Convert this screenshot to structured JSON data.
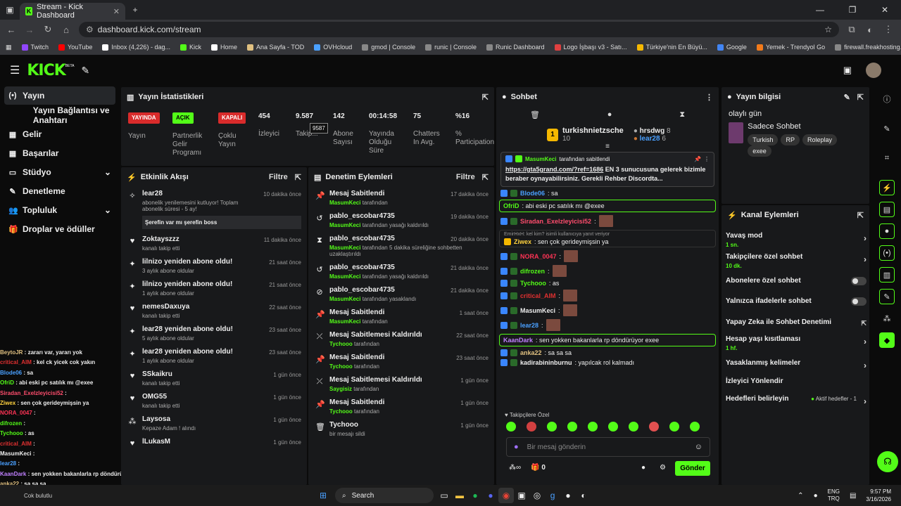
{
  "browser": {
    "tab_title": "Stream - Kick Dashboard",
    "url": "dashboard.kick.com/stream",
    "bookmarks": [
      "Twitch",
      "YouTube",
      "Inbox (4,226) - dag...",
      "Kick",
      "Home",
      "Ana Sayfa - TOD",
      "OVHcloud",
      "gmod | Console",
      "runic | Console",
      "Runic Dashboard",
      "Logo İşbaşı v3 - Satı...",
      "Türkiye'nin En Büyü...",
      "Google",
      "Yemek - Trendyol Go",
      "firewall.freakhosting..."
    ]
  },
  "brand": {
    "logo": "KICK",
    "beta": "BETA"
  },
  "sidebar": {
    "items": [
      {
        "label": "Yayın",
        "icon": "(•)"
      },
      {
        "label": "Yayın Bağlantısı ve Anahtarı",
        "icon": ""
      },
      {
        "label": "Gelir",
        "icon": "▦"
      },
      {
        "label": "Başarılar",
        "icon": "▦"
      },
      {
        "label": "Stüdyo",
        "icon": "▭"
      },
      {
        "label": "Denetleme",
        "icon": "✎"
      },
      {
        "label": "Topluluk",
        "icon": "👥"
      },
      {
        "label": "Droplar ve ödüller",
        "icon": "🎁"
      }
    ]
  },
  "overlay_chat": [
    {
      "user": "BeytoJR",
      "text": " : zararı var, yararı yok",
      "color": "#e0c080"
    },
    {
      "user": "critical_AIM",
      "text": " : kel ck yicek cok yakın",
      "color": "#e03030"
    },
    {
      "user": "Blode06",
      "text": " : sa",
      "color": "#4aa0ff"
    },
    {
      "user": "OfriD",
      "text": " : abi eski pc satılık mı @exee",
      "color": "#53fc18"
    },
    {
      "user": "Siradan_Exelzleyicisi52",
      "text": " :",
      "color": "#ff4d6d"
    },
    {
      "user": "Ziwex",
      "text": " : sen çok gerideymişsin ya",
      "color": "#ffd23f"
    },
    {
      "user": "NORA_0047",
      "text": " :",
      "color": "#ff3355"
    },
    {
      "user": "difrozen",
      "text": " :",
      "color": "#53fc18"
    },
    {
      "user": "Tychooo",
      "text": " : as",
      "color": "#53fc18"
    },
    {
      "user": "critical_AIM",
      "text": " :",
      "color": "#e03030"
    },
    {
      "user": "MasumKeci",
      "text": " :",
      "color": "#eeeeee"
    },
    {
      "user": "lear28",
      "text": " :",
      "color": "#4aa0ff"
    },
    {
      "user": "KaanDark",
      "text": " : sen yokken bakanlarla rp döndürüyor exee",
      "color": "#c080ff"
    },
    {
      "user": "anka22",
      "text": " : sa sa sa",
      "color": "#e0c080"
    },
    {
      "user": "kadirabininburnu",
      "text": " : yapılcak rol kalmadı",
      "color": "#eeeeee"
    }
  ],
  "stats": {
    "title": "Yayın İstatistikleri",
    "live": {
      "badge": "YAYINDA",
      "label": "Yayın"
    },
    "partner": {
      "badge": "AÇIK",
      "label": "Partnerlik Gelir Programı"
    },
    "multi": {
      "badge": "KAPALI",
      "label": "Çoklu Yayın"
    },
    "viewers": {
      "value": "454",
      "label": "İzleyici"
    },
    "followers": {
      "value": "9.587",
      "label": "Takip...",
      "tooltip": "9587"
    },
    "subs": {
      "value": "142",
      "label": "Abone Sayısı"
    },
    "uptime": {
      "value": "00:14:58",
      "label": "Yayında Olduğu Süre"
    },
    "chatters": {
      "value": "75",
      "label": "Chatters In Avg."
    },
    "participation": {
      "value": "%16",
      "label": "% Participation"
    }
  },
  "activity": {
    "title": "Etkinlik Akışı",
    "filter": "Filtre",
    "items": [
      {
        "icon": "✧",
        "title": "lear28",
        "sub": "abonelik yenilemesini kutluyor! Toplam abonelik süresi - 5 ay!",
        "time": "10 dakika önce",
        "msg": "Şerefin var mı şerefin boss"
      },
      {
        "icon": "♥",
        "title": "Zoktayszzz",
        "sub": "kanalı takip etti",
        "time": "11 dakika önce"
      },
      {
        "icon": "✦",
        "title": "lilnizo yeniden abone oldu!",
        "sub": "3 aylık abone oldular",
        "time": "21 saat önce"
      },
      {
        "icon": "✦",
        "title": "lilnizo yeniden abone oldu!",
        "sub": "1 aylık abone oldular",
        "time": "21 saat önce"
      },
      {
        "icon": "♥",
        "title": "nemesDaxuya",
        "sub": "kanalı takip etti",
        "time": "22 saat önce"
      },
      {
        "icon": "✦",
        "title": "lear28 yeniden abone oldu!",
        "sub": "5 aylık abone oldular",
        "time": "23 saat önce"
      },
      {
        "icon": "✦",
        "title": "lear28 yeniden abone oldu!",
        "sub": "1 aylık abone oldular",
        "time": "23 saat önce"
      },
      {
        "icon": "♥",
        "title": "SSkaikru",
        "sub": "kanalı takip etti",
        "time": "1 gün önce"
      },
      {
        "icon": "♥",
        "title": "OMG55",
        "sub": "kanalı takip etti",
        "time": "1 gün önce"
      },
      {
        "icon": "⁂",
        "title": "Laysosa",
        "sub": "Kepaze Adam ! alındı",
        "time": "1 gün önce"
      },
      {
        "icon": "♥",
        "title": "lLukasM",
        "sub": "",
        "time": "1 gün önce"
      }
    ]
  },
  "moderation": {
    "title": "Denetim Eylemleri",
    "filter": "Filtre",
    "items": [
      {
        "icon": "📌",
        "title": "Mesaj Sabitlendi",
        "user": "MasumKeci",
        "sub": " tarafından",
        "time": "17 dakika önce"
      },
      {
        "icon": "↺",
        "title": "pablo_escobar4735",
        "user": "MasumKeci",
        "sub": " tarafından yasağı kaldırıldı",
        "time": "19 dakika önce"
      },
      {
        "icon": "⧗",
        "title": "pablo_escobar4735",
        "user": "MasumKeci",
        "sub": " tarafından 5 dakika süreliğine sohbetten uzaklaştırıldı",
        "time": "20 dakika önce"
      },
      {
        "icon": "↺",
        "title": "pablo_escobar4735",
        "user": "MasumKeci",
        "sub": " tarafından yasağı kaldırıldı",
        "time": "21 dakika önce"
      },
      {
        "icon": "⊘",
        "title": "pablo_escobar4735",
        "user": "MasumKeci",
        "sub": " tarafından yasaklandı",
        "time": "21 dakika önce"
      },
      {
        "icon": "📌",
        "title": "Mesaj Sabitlendi",
        "user": "MasumKeci",
        "sub": " tarafından",
        "time": "1 saat önce"
      },
      {
        "icon": "⤫",
        "title": "Mesaj Sabitlemesi Kaldırıldı",
        "user": "Tychooo",
        "sub": " tarafından",
        "time": "22 saat önce"
      },
      {
        "icon": "📌",
        "title": "Mesaj Sabitlendi",
        "user": "Tychooo",
        "sub": " tarafından",
        "time": "23 saat önce"
      },
      {
        "icon": "⤫",
        "title": "Mesaj Sabitlemesi Kaldırıldı",
        "user": "Saygisiz",
        "sub": " tarafından",
        "time": "1 gün önce"
      },
      {
        "icon": "📌",
        "title": "Mesaj Sabitlendi",
        "user": "Tychooo",
        "sub": " tarafından",
        "time": "1 gün önce"
      },
      {
        "icon": "🗑",
        "title": "Tychooo",
        "user": "",
        "sub": "bir mesajı sildi",
        "time": "1 gün önce"
      }
    ]
  },
  "chat": {
    "title": "Sohbet",
    "top": {
      "first": "turkishnietzsche",
      "first_count": "10",
      "second": "hrsdwg",
      "second_count": "8",
      "third": "lear28",
      "third_count": "6"
    },
    "pinned": {
      "by": "MasumKeci",
      "by_suffix": " tarafından sabitlendi",
      "link": "https://gta5grand.com/?ref=1686",
      "text": " EN 3 sunucusuna gelerek bizimle beraber oynayabilirsiniz. Gerekli Rehber Discordta..."
    },
    "messages": [
      {
        "user": "Blode06",
        "color": "#4aa0ff",
        "text": ": sa",
        "hl": false
      },
      {
        "user": "OfriD",
        "color": "#53fc18",
        "text": ": abi eski pc satılık mı @exee",
        "hl": true
      },
      {
        "user": "Siradan_Exelzleyicisi52",
        "color": "#ff4d6d",
        "text": ":",
        "hl": false,
        "emote": true
      },
      {
        "user": "Ziwex",
        "color": "#ffd23f",
        "text": ": sen çok gerideymişsin ya",
        "hl": false,
        "reply": "EmirHxH: kel kim? isimli kullanıcıya yanıt veriyor"
      },
      {
        "user": "NORA_0047",
        "color": "#ff3355",
        "text": ":",
        "hl": false,
        "emote": true
      },
      {
        "user": "difrozen",
        "color": "#53fc18",
        "text": ":",
        "hl": false,
        "emote": true
      },
      {
        "user": "Tychooo",
        "color": "#53fc18",
        "text": ": as",
        "hl": false
      },
      {
        "user": "critical_AIM",
        "color": "#e03030",
        "text": ":",
        "hl": false,
        "emote": true
      },
      {
        "user": "MasumKeci",
        "color": "#eeeeee",
        "text": ":",
        "hl": false,
        "emote": true
      },
      {
        "user": "lear28",
        "color": "#4aa0ff",
        "text": ":",
        "hl": false,
        "emote": true
      },
      {
        "user": "KaanDark",
        "color": "#c080ff",
        "text": ": sen yokken bakanlarla rp döndürüyor exee",
        "hl": true
      },
      {
        "user": "anka22",
        "color": "#e0c080",
        "text": ": sa sa sa",
        "hl": false
      },
      {
        "user": "kadirabininburnu",
        "color": "#eeeeee",
        "text": ": yapılcak rol kalmadı",
        "hl": false
      }
    ],
    "follower_only": "Takipçilere Özel",
    "placeholder": "Bir mesaj gönderin",
    "send": "Gönder",
    "count": "0"
  },
  "info": {
    "title": "Yayın bilgisi",
    "stream_title": "olaylı gün",
    "category": "Sadece Sohbet",
    "tags": [
      "Turkish",
      "RP",
      "Roleplay",
      "exee"
    ]
  },
  "actions": {
    "title": "Kanal Eylemleri",
    "slow": {
      "label": "Yavaş mod",
      "value": "1 sn."
    },
    "followers": {
      "label": "Takipçilere özel sohbet",
      "value": "10 dk."
    },
    "subs": {
      "label": "Abonelere özel sohbet"
    },
    "emotes": {
      "label": "Yalnızca ifadelerle sohbet"
    },
    "ai": {
      "label": "Yapay Zeka ile Sohbet Denetimi"
    },
    "age": {
      "label": "Hesap yaşı kısıtlaması",
      "value": "1 hf."
    },
    "banned": {
      "label": "Yasaklanmış kelimeler"
    },
    "redirect": {
      "label": "İzleyici Yönlendir"
    },
    "goals": {
      "label": "Hedefleri belirleyin",
      "status": "Aktif hedefler - 1"
    }
  },
  "taskbar": {
    "search": "Search",
    "lang": "ENG",
    "lang2": "TRQ",
    "time": "9:57 PM",
    "date": "3/16/2026",
    "notif": "Cok bulutlu"
  }
}
